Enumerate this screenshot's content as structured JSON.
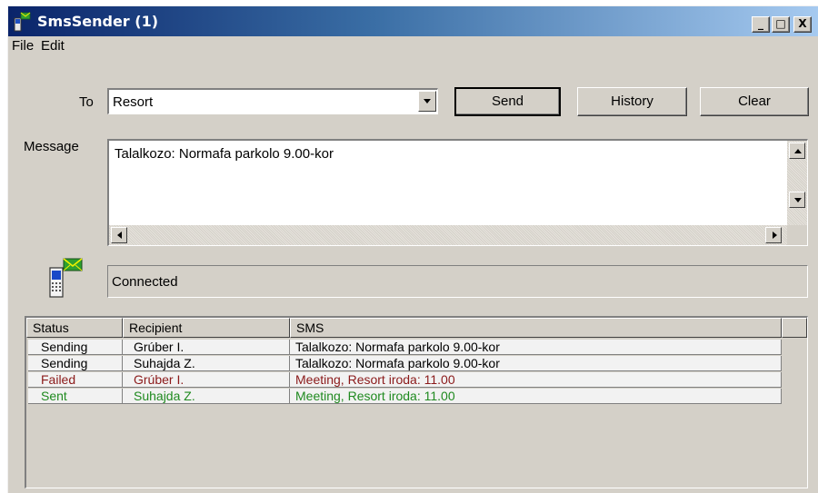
{
  "window": {
    "title": "SmsSender (1)",
    "controls": {
      "minimize": "_",
      "maximize": "□",
      "close": "X"
    }
  },
  "menu": {
    "file": "File",
    "edit": "Edit"
  },
  "form": {
    "to_label": "To",
    "to_value": "Resort",
    "message_label": "Message",
    "message_text": "Talalkozo: Normafa parkolo 9.00-kor",
    "status": "Connected"
  },
  "buttons": {
    "send": "Send",
    "history": "History",
    "clear": "Clear"
  },
  "table": {
    "columns": [
      "Status",
      "Recipient",
      "SMS"
    ],
    "rows": [
      {
        "status": "Sending",
        "recipient": "Grúber I.",
        "sms": "Talalkozo: Normafa parkolo 9.00-kor",
        "color": "#000000"
      },
      {
        "status": "Sending",
        "recipient": "Suhajda Z.",
        "sms": "Talalkozo: Normafa parkolo 9.00-kor",
        "color": "#000000"
      },
      {
        "status": "Failed",
        "recipient": "Grúber I.",
        "sms": "Meeting, Resort iroda: 11.00",
        "color": "#8b1a1a"
      },
      {
        "status": "Sent",
        "recipient": "Suhajda Z.",
        "sms": "Meeting, Resort iroda: 11.00",
        "color": "#1f8a1f"
      }
    ]
  },
  "icons": {
    "app": "phone-envelope-icon",
    "status": "phone-envelope-icon"
  }
}
